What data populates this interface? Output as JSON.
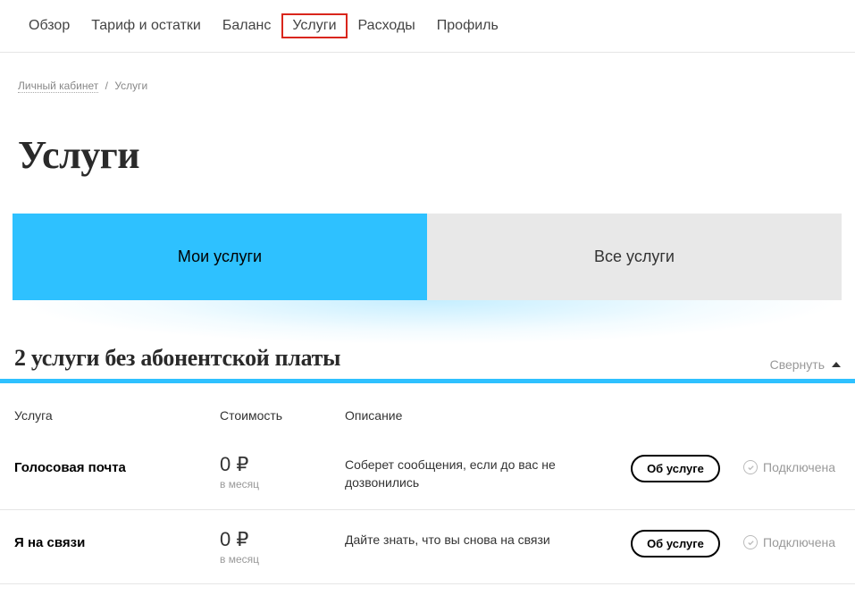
{
  "nav": {
    "items": [
      {
        "label": "Обзор",
        "highlighted": false
      },
      {
        "label": "Тариф и остатки",
        "highlighted": false
      },
      {
        "label": "Баланс",
        "highlighted": false
      },
      {
        "label": "Услуги",
        "highlighted": true
      },
      {
        "label": "Расходы",
        "highlighted": false
      },
      {
        "label": "Профиль",
        "highlighted": false
      }
    ]
  },
  "breadcrumb": {
    "link": "Личный кабинет",
    "current": "Услуги"
  },
  "page_title": "Услуги",
  "tabs": {
    "my": "Мои услуги",
    "all": "Все услуги"
  },
  "section": {
    "title": "2 услуги без абонентской платы",
    "collapse": "Свернуть"
  },
  "table": {
    "headers": {
      "service": "Услуга",
      "cost": "Стоимость",
      "desc": "Описание"
    },
    "rows": [
      {
        "name": "Голосовая почта",
        "cost": "0 ₽",
        "period": "в месяц",
        "desc": "Соберет сообщения, если до вас не дозвонились",
        "action": "Об услуге",
        "status": "Подключена"
      },
      {
        "name": "Я на связи",
        "cost": "0 ₽",
        "period": "в месяц",
        "desc": "Дайте знать, что вы снова на связи",
        "action": "Об услуге",
        "status": "Подключена"
      }
    ]
  }
}
